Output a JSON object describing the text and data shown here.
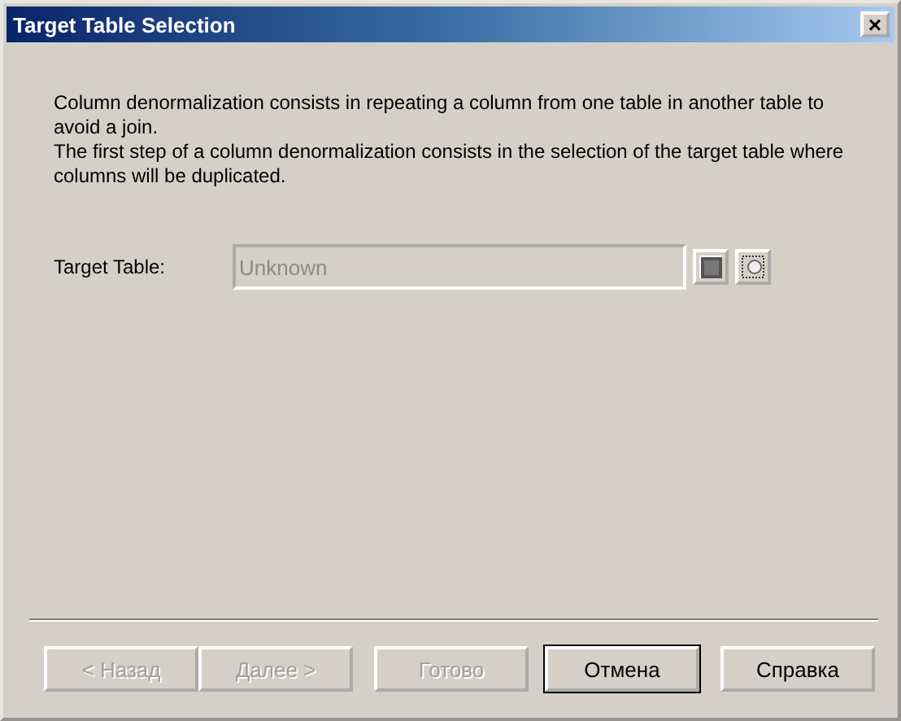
{
  "window": {
    "title": "Target Table Selection",
    "close": "×"
  },
  "description": [
    "Column denormalization consists in repeating a column from one table in another table to avoid a join.",
    "The first step of a column denormalization consists in the selection of the target table where columns will be duplicated."
  ],
  "target_table": {
    "label": "Target Table:",
    "value": "Unknown",
    "disabled": true
  },
  "buttons": [
    {
      "label": "< Назад",
      "disabled": true,
      "default": false
    },
    {
      "label": "Далее >",
      "disabled": true,
      "default": false
    },
    {
      "label": "Готово",
      "disabled": true,
      "default": false
    },
    {
      "label": "Отмена",
      "disabled": false,
      "default": true
    },
    {
      "label": "Справка",
      "disabled": false,
      "default": false
    }
  ]
}
